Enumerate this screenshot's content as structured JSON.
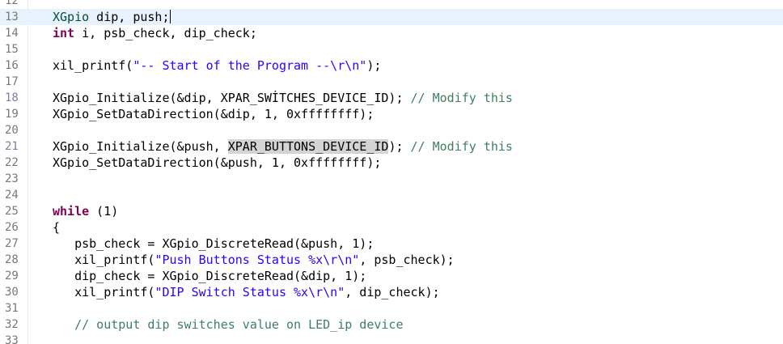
{
  "editor": {
    "lines": [
      {
        "num": "12",
        "tokens": []
      },
      {
        "num": "13",
        "current": true,
        "caret": true,
        "tokens": [
          {
            "t": "XGpio",
            "c": "type"
          },
          {
            "t": " dip, push;"
          }
        ]
      },
      {
        "num": "14",
        "tokens": [
          {
            "t": "int",
            "c": "kw"
          },
          {
            "t": " i, psb_check, dip_check;"
          }
        ]
      },
      {
        "num": "15",
        "tokens": []
      },
      {
        "num": "16",
        "tokens": [
          {
            "t": "xil_printf("
          },
          {
            "t": "\"-- Start of the Program --\\r\\n\"",
            "c": "str"
          },
          {
            "t": ");"
          }
        ]
      },
      {
        "num": "17",
        "tokens": []
      },
      {
        "num": "18",
        "marked": true,
        "tokens": [
          {
            "t": "XGpio_Initialize(&dip, XPAR_SWİTCHES_DEVICE_ID); "
          },
          {
            "t": "// Modify this",
            "c": "cmt"
          }
        ]
      },
      {
        "num": "19",
        "tokens": [
          {
            "t": "XGpio_SetDataDirection(&dip, 1, 0xffffffff);"
          }
        ]
      },
      {
        "num": "20",
        "tokens": []
      },
      {
        "num": "21",
        "marked": true,
        "tokens": [
          {
            "t": "XGpio_Initialize(&push, "
          },
          {
            "t": "XPAR_BUTTONS_DEVICE_ID",
            "c": "hl"
          },
          {
            "t": "); "
          },
          {
            "t": "// Modify this",
            "c": "cmt"
          }
        ]
      },
      {
        "num": "22",
        "tokens": [
          {
            "t": "XGpio_SetDataDirection(&push, 1, 0xffffffff);"
          }
        ]
      },
      {
        "num": "23",
        "tokens": []
      },
      {
        "num": "24",
        "tokens": []
      },
      {
        "num": "25",
        "tokens": [
          {
            "t": "while",
            "c": "kw"
          },
          {
            "t": " (1)"
          }
        ]
      },
      {
        "num": "26",
        "tokens": [
          {
            "t": "{"
          }
        ]
      },
      {
        "num": "27",
        "tokens": [
          {
            "t": "   psb_check = XGpio_DiscreteRead(&push, 1);"
          }
        ]
      },
      {
        "num": "28",
        "tokens": [
          {
            "t": "   xil_printf("
          },
          {
            "t": "\"Push Buttons Status %x\\r\\n\"",
            "c": "str"
          },
          {
            "t": ", psb_check);"
          }
        ]
      },
      {
        "num": "29",
        "tokens": [
          {
            "t": "   dip_check = XGpio_DiscreteRead(&dip, 1);"
          }
        ]
      },
      {
        "num": "30",
        "tokens": [
          {
            "t": "   xil_printf("
          },
          {
            "t": "\"DIP Switch Status %x\\r\\n\"",
            "c": "str"
          },
          {
            "t": ", dip_check);"
          }
        ]
      },
      {
        "num": "31",
        "tokens": []
      },
      {
        "num": "32",
        "tokens": [
          {
            "t": "   "
          },
          {
            "t": "// output dip switches value on LED_ip device",
            "c": "cmt"
          }
        ]
      },
      {
        "num": "33",
        "tokens": []
      }
    ]
  }
}
